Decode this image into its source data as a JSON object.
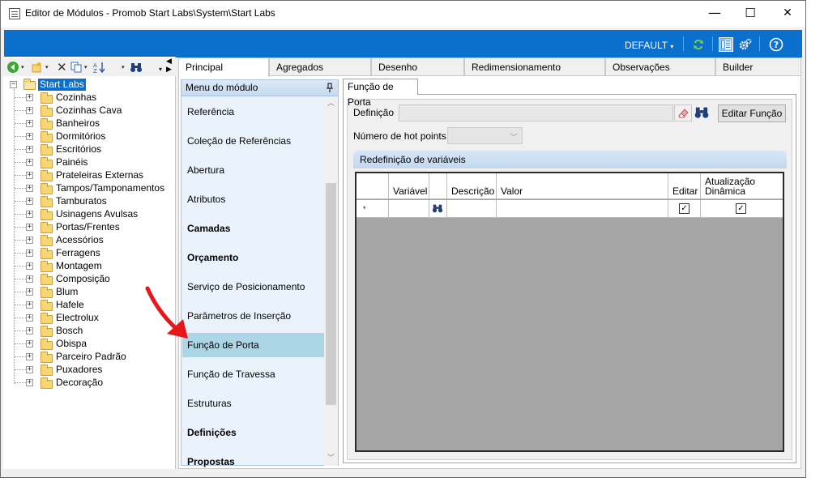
{
  "window": {
    "title": "Editor de Módulos - Promob Start Labs\\System\\Start Labs",
    "minimize": "—",
    "maximize": "☐",
    "close": "✕"
  },
  "bluebar": {
    "profile": "DEFAULT",
    "icons": [
      "refresh-icon",
      "panel-icon",
      "settings-icon",
      "help-icon"
    ],
    "accent_color": "#0b6fce"
  },
  "tree": {
    "root": "Start Labs",
    "items": [
      "Cozinhas",
      "Cozinhas Cava",
      "Banheiros",
      "Dormitórios",
      "Escritórios",
      "Painéis",
      "Prateleiras Externas",
      "Tampos/Tamponamentos",
      "Tamburatos",
      "Usinagens Avulsas",
      "Portas/Frentes",
      "Acessórios",
      "Ferragens",
      "Montagem",
      "Composição",
      "Blum",
      "Hafele",
      "Electrolux",
      "Bosch",
      "Obispa",
      "Parceiro Padrão",
      "Puxadores",
      "Decoração"
    ]
  },
  "tabs": [
    {
      "label": "Principal"
    },
    {
      "label": "Agregados"
    },
    {
      "label": "Desenho"
    },
    {
      "label": "Redimensionamento"
    },
    {
      "label": "Observações"
    },
    {
      "label": "Builder"
    }
  ],
  "menu": {
    "title": "Menu do módulo",
    "items": [
      {
        "label": "Referência",
        "bold": false
      },
      {
        "label": "Coleção de Referências",
        "bold": false
      },
      {
        "label": "Abertura",
        "bold": false
      },
      {
        "label": "Atributos",
        "bold": false
      },
      {
        "label": "Camadas",
        "bold": true
      },
      {
        "label": "Orçamento",
        "bold": true
      },
      {
        "label": "Serviço de Posicionamento",
        "bold": false
      },
      {
        "label": "Parâmetros de Inserção",
        "bold": false
      },
      {
        "label": "Função de Porta",
        "bold": false
      },
      {
        "label": "Função de Travessa",
        "bold": false
      },
      {
        "label": "Estruturas",
        "bold": false
      },
      {
        "label": "Definições",
        "bold": true
      },
      {
        "label": "Propostas",
        "bold": true
      }
    ],
    "selected_index": 8
  },
  "detail": {
    "tab": "Função de Porta",
    "definition_label": "Definição",
    "definition_value": "",
    "edit_function_button": "Editar Função",
    "hot_points_label": "Número de hot points",
    "hot_points_value": "",
    "group_title": "Redefinição de variáveis",
    "grid": {
      "columns": [
        "Variável",
        "",
        "Descrição",
        "Valor",
        "Editar",
        "Atualização Dinâmica"
      ],
      "new_row_marker": "*",
      "editar_checked": true,
      "atualizacao_checked": true
    }
  }
}
